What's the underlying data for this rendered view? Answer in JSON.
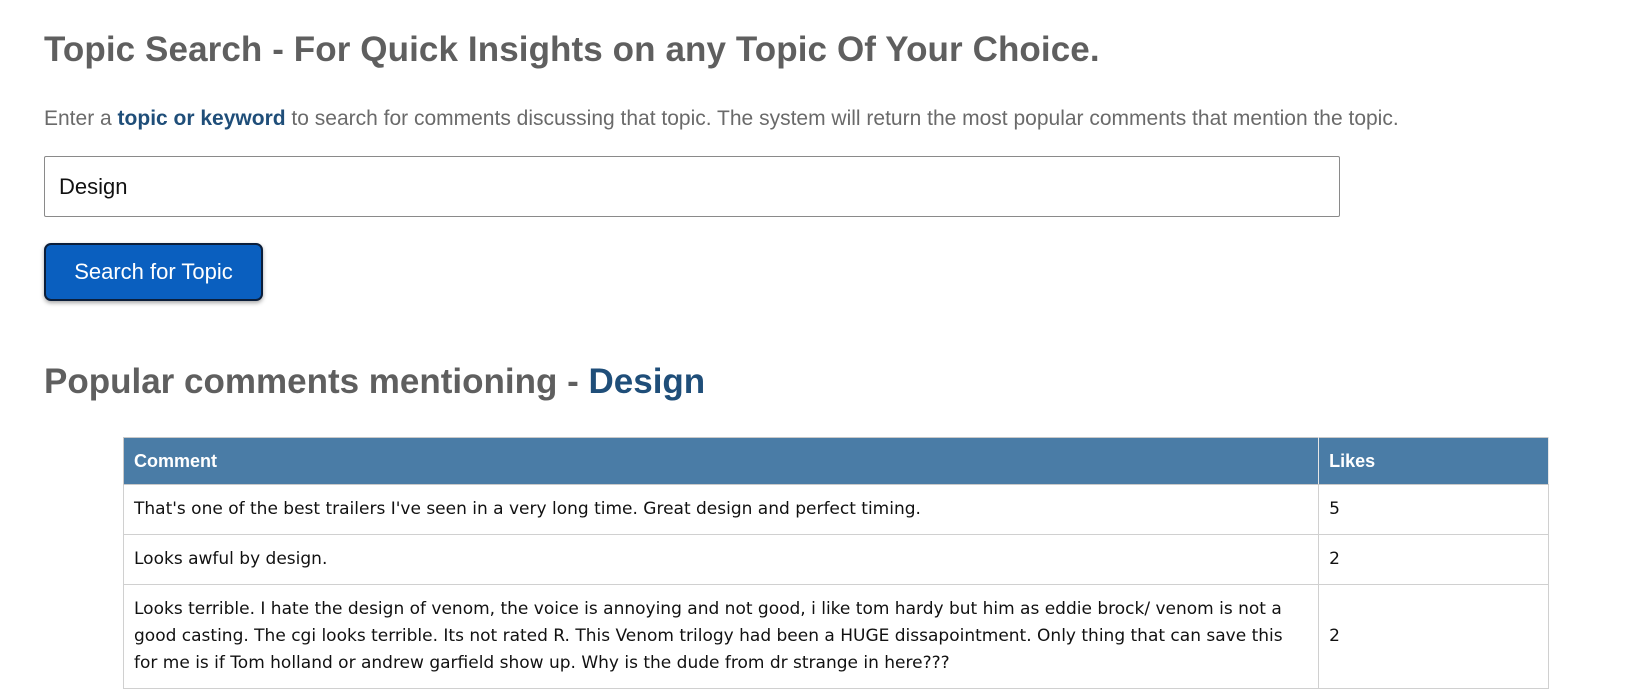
{
  "header": {
    "title": "Topic Search - For Quick Insights on any Topic Of Your Choice."
  },
  "intro": {
    "prefix": "Enter a ",
    "keyword": "topic or keyword",
    "suffix": " to search for comments discussing that topic. The system will return the most popular comments that mention the topic."
  },
  "search": {
    "value": "Design",
    "button_label": "Search for Topic"
  },
  "results": {
    "heading_prefix": "Popular comments mentioning - ",
    "heading_topic": "Design",
    "columns": [
      "Comment",
      "Likes"
    ],
    "rows": [
      {
        "comment": "That's one of the best trailers I've seen in a very long time. Great design and perfect timing.",
        "likes": "5"
      },
      {
        "comment": "Looks awful by design.",
        "likes": "2"
      },
      {
        "comment": "Looks terrible. I hate the design of venom, the voice is annoying and not good, i like tom hardy but him as eddie brock/ venom is not a good casting. The cgi looks terrible. Its not rated R. This Venom trilogy had been a HUGE dissapointment. Only thing that can save this for me is if Tom holland or andrew garfield show up. Why is the dude from dr strange in here???",
        "likes": "2"
      }
    ]
  },
  "colors": {
    "accent": "#1f4e79",
    "button": "#0a5fbf",
    "table_header": "#4a7ca6",
    "text": "#5f5f5f"
  }
}
